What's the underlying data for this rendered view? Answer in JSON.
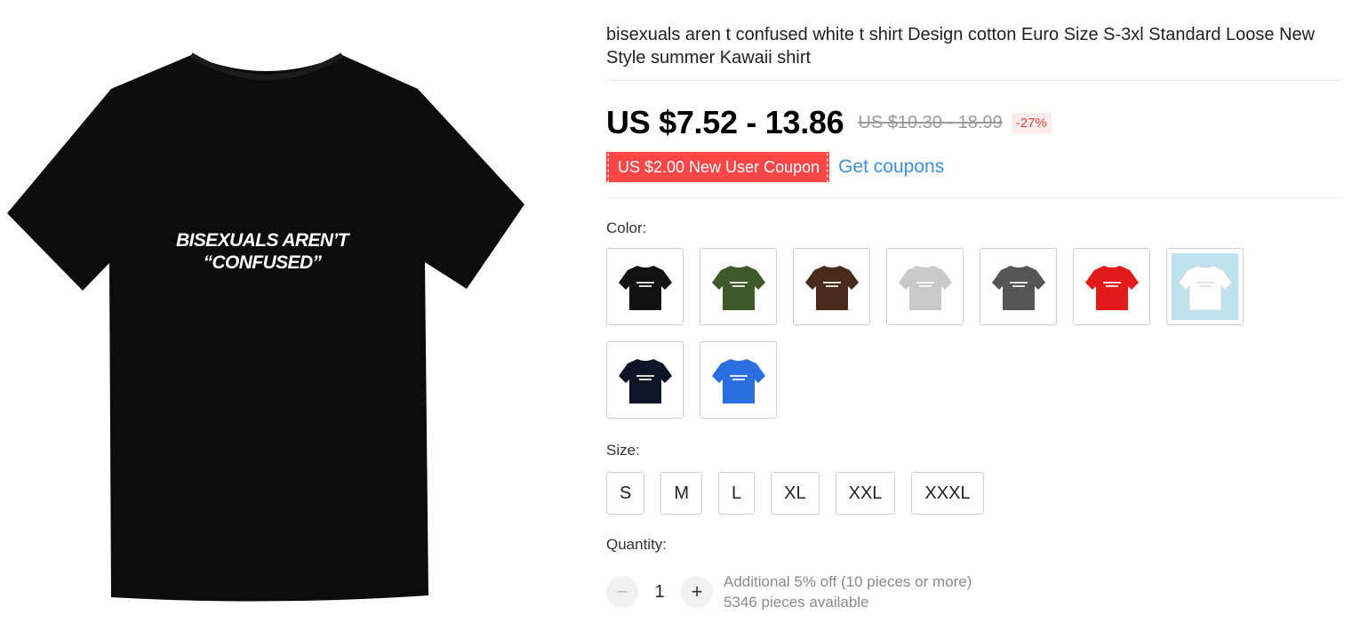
{
  "product": {
    "print_line1": "BISEXUALS AREN’T",
    "print_line2": "“CONFUSED”",
    "title": "bisexuals aren t confused white t shirt Design cotton Euro Size S-3xl Standard Loose New Style summer Kawaii shirt"
  },
  "pricing": {
    "price": "US $7.52 - 13.86",
    "original_price": "US $10.30 - 18.99",
    "discount": "-27%"
  },
  "coupon": {
    "label": "US $2.00 New User Coupon",
    "link": "Get coupons"
  },
  "color": {
    "label": "Color:",
    "options": [
      {
        "name": "black",
        "hex": "#111111"
      },
      {
        "name": "army-green",
        "hex": "#3f5a2a"
      },
      {
        "name": "brown",
        "hex": "#4a2a1a"
      },
      {
        "name": "light-gray",
        "hex": "#c9c9c9"
      },
      {
        "name": "dark-gray",
        "hex": "#555555"
      },
      {
        "name": "red",
        "hex": "#e21a1a"
      },
      {
        "name": "white",
        "hex": "#ffffff",
        "background": "#bfe2f1"
      },
      {
        "name": "navy",
        "hex": "#0d1425"
      },
      {
        "name": "royal-blue",
        "hex": "#2a6ee0"
      }
    ]
  },
  "size": {
    "label": "Size:",
    "options": [
      "S",
      "M",
      "L",
      "XL",
      "XXL",
      "XXXL"
    ]
  },
  "quantity": {
    "label": "Quantity:",
    "value": "1",
    "minus": "−",
    "plus": "+",
    "bulk_note": "Additional 5% off (10 pieces or more)",
    "available": "5346 pieces available"
  },
  "colors": {
    "shirt_main": "#0c0c0c",
    "coupon_bg": "#ff4747",
    "link": "#3f8fd6",
    "discount": "#f44336"
  }
}
